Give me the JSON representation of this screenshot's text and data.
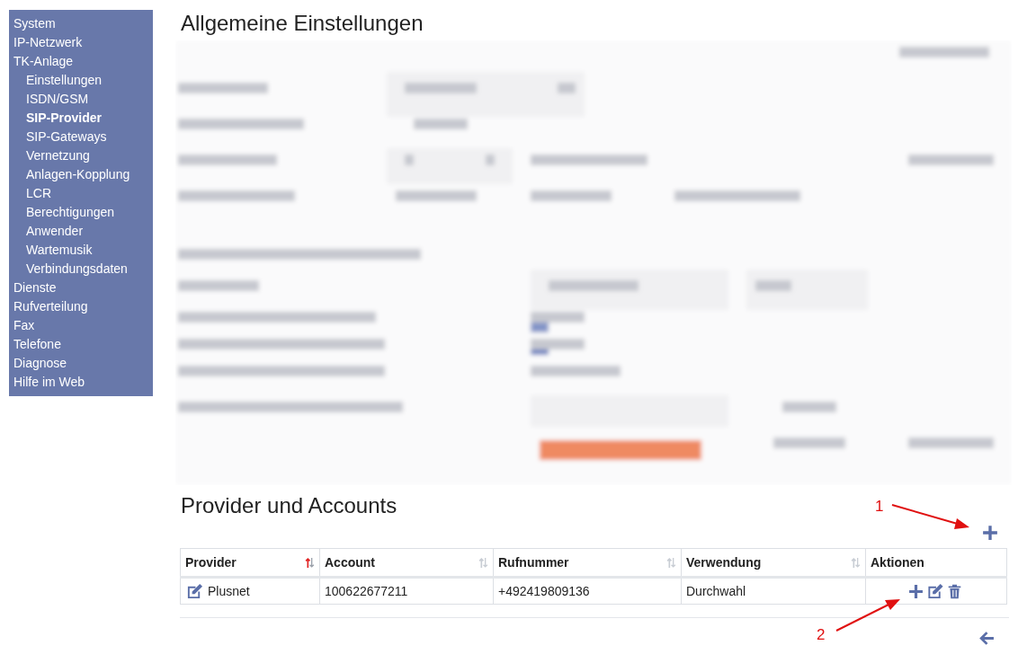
{
  "sidebar": {
    "items": [
      {
        "label": "System",
        "selected": false
      },
      {
        "label": "IP-Netzwerk",
        "selected": false
      },
      {
        "label": "TK-Anlage",
        "selected": false,
        "children": [
          {
            "label": "Einstellungen",
            "selected": false
          },
          {
            "label": "ISDN/GSM",
            "selected": false
          },
          {
            "label": "SIP-Provider",
            "selected": true
          },
          {
            "label": "SIP-Gateways",
            "selected": false
          },
          {
            "label": "Vernetzung",
            "selected": false
          },
          {
            "label": "Anlagen-Kopplung",
            "selected": false
          },
          {
            "label": "LCR",
            "selected": false
          },
          {
            "label": "Berechtigungen",
            "selected": false
          },
          {
            "label": "Anwender",
            "selected": false
          },
          {
            "label": "Wartemusik",
            "selected": false
          },
          {
            "label": "Verbindungsdaten",
            "selected": false
          }
        ]
      },
      {
        "label": "Dienste",
        "selected": false
      },
      {
        "label": "Rufverteilung",
        "selected": false
      },
      {
        "label": "Fax",
        "selected": false
      },
      {
        "label": "Telefone",
        "selected": false
      },
      {
        "label": "Diagnose",
        "selected": false
      },
      {
        "label": "Hilfe im Web",
        "selected": false
      }
    ]
  },
  "general": {
    "title": "Allgemeine Einstellungen"
  },
  "accounts": {
    "title": "Provider und Accounts",
    "columns": [
      {
        "label": "Provider",
        "sorted": true
      },
      {
        "label": "Account",
        "sorted": false
      },
      {
        "label": "Rufnummer",
        "sorted": false
      },
      {
        "label": "Verwendung",
        "sorted": false
      },
      {
        "label": "Aktionen"
      }
    ],
    "rows": [
      {
        "provider": "Plusnet",
        "account": "100622677211",
        "number": "+492419809136",
        "usage": "Durchwahl"
      }
    ]
  },
  "annotations": [
    {
      "label": "1"
    },
    {
      "label": "2"
    }
  ]
}
